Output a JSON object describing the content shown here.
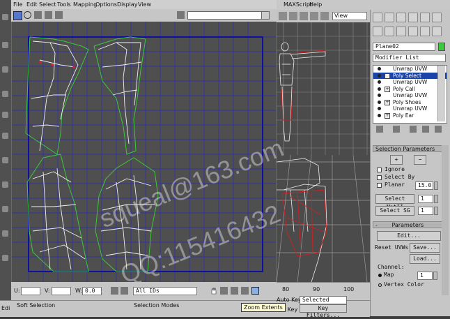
{
  "uv_editor": {
    "menu": [
      "File",
      "Edit",
      "Select",
      "Tools",
      "Mapping",
      "Options",
      "Display",
      "View"
    ],
    "filter_dropdown": "All IDs",
    "u_label": "U:",
    "v_label": "V:",
    "w_label": "W:",
    "w_value": "0.0",
    "tooltip": "Zoom Extents"
  },
  "main_menu": [
    "MAXScript",
    "Help"
  ],
  "view_dropdown": "View",
  "command_panel": {
    "object_name": "Plane02",
    "object_color": "#3cc83c",
    "modifier_list": "Modifier List",
    "stack": [
      {
        "label": "Unwrap UVW",
        "selected": false,
        "expand": false
      },
      {
        "label": "Poly Select",
        "selected": true,
        "expand": true
      },
      {
        "label": "Unwrap UVW",
        "selected": false,
        "expand": false
      },
      {
        "label": "Poly Call",
        "selected": false,
        "expand": true
      },
      {
        "label": "Unwrap UVW",
        "selected": false,
        "expand": false
      },
      {
        "label": "Poly Shoes",
        "selected": false,
        "expand": true
      },
      {
        "label": "Unwrap UVW",
        "selected": false,
        "expand": false
      },
      {
        "label": "Poly Ear",
        "selected": false,
        "expand": true
      }
    ],
    "selection_parameters": {
      "title": "Selection Parameters",
      "plus": "+",
      "minus": "−",
      "ignore": "Ignore",
      "select_by": "Select By",
      "planar": "Planar",
      "planar_value": "15.0",
      "select_matid": "Select MatII",
      "matid_value": "1",
      "select_sg": "Select SG",
      "sg_value": "1"
    },
    "parameters": {
      "title": "Parameters",
      "edit_button": "Edit...",
      "reset_uvws": "Reset UVWs",
      "save_button": "Save...",
      "load_button": "Load...",
      "channel": "Channel:",
      "map_label": "Map",
      "map_value": "1",
      "vertex_color": "Vertex Color"
    }
  },
  "status_bar": {
    "soft_selection": "Soft Selection",
    "selection_modes": "Selection Modes",
    "auto_key": "Auto Key",
    "selected_dropdown": "Selected",
    "set_key": "Set Key",
    "key_filters": "Key Filters...",
    "timeline_ticks": [
      "80",
      "90",
      "100"
    ],
    "edit_label": "Edi"
  },
  "watermark": {
    "line1": "squeal@163.com",
    "line2": "QQ:115416432"
  },
  "colors": {
    "uv_grid": "#2a2ab8",
    "uv_border": "#1010a0",
    "mesh_green": "#3cc83c",
    "mesh_white": "#f0f0f0",
    "selected_vertex": "#e02020",
    "stack_select": "#1a44a8"
  }
}
